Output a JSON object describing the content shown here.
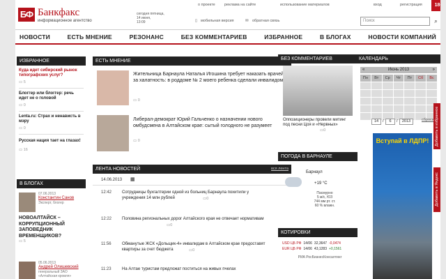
{
  "header": {
    "logo_short": "БФ",
    "logo_name": "Банкфакс",
    "logo_sub": "информационное агентство",
    "date_lines": [
      "сегодня пятница,",
      "14 июня,",
      "13:09"
    ],
    "top_links": [
      "о проекте",
      "реклама на сайте",
      "использование материалов"
    ],
    "login": "вход",
    "register": "регистрация",
    "age": "18+",
    "mobile": "мобильная версия",
    "feedback": "обратная связь",
    "search_placeholder": "Поиск"
  },
  "nav": [
    "НОВОСТИ",
    "ЕСТЬ МНЕНИЕ",
    "РЕЗОНАНС",
    "БЕЗ КОММЕНТАРИЕВ",
    "ИЗБРАННОЕ",
    "В БЛОГАХ",
    "НОВОСТИ КОМПАНИЙ"
  ],
  "featured": {
    "title": "ИЗБРАННОЕ",
    "items": [
      {
        "text": "Куда идет сибирский рынок типографских услуг?",
        "comments": "5"
      },
      {
        "text": "Блоггер или блоггер: речь идет не о головой",
        "comments": "0"
      },
      {
        "text": "Lenta.ru: Страх и ненависть в мэру",
        "comments": "0"
      },
      {
        "text": "Русская нация тает на глазах!",
        "comments": "16"
      }
    ]
  },
  "blogs": {
    "title": "В БЛОГАХ",
    "items": [
      {
        "date": "07.06.2013",
        "author": "Константин Санов",
        "role": "Эксперт, блогер",
        "text": "НОВОАЛТАЙСК – КОРРУПЦИОННЫЙ ЗАПОВЕДНИК ВРЕМЕНЩИКОВ?",
        "comments": "5"
      },
      {
        "date": "05.06.2013",
        "author": "Андрей Олишевский",
        "role": "генеральный ЗАО «Алтайская кровля»",
        "text": ""
      }
    ]
  },
  "opinion": {
    "title": "ЕСТЬ МНЕНИЕ",
    "items": [
      {
        "text": "Жительница Барнаула Наталья Игошина требует наказать врачей за халатность: в роддоме № 2 моего ребенка сделали инвалидом!",
        "comments": "0"
      },
      {
        "text": "Либерал-демократ Юрий Гальченко о назначении нового омбудсмена в Алтайском крае: сытый голодного не разумеет",
        "comments": "0"
      }
    ]
  },
  "feed": {
    "title": "ЛЕНТА НОВОСТЕЙ",
    "all_label": "вся лента",
    "date": "14.06.2013",
    "items": [
      {
        "time": "12:42",
        "text": "Сотрудницы бухгалтерии одной из больниц Барнаула похитили у учреждения 14 млн рублей",
        "comments": "0"
      },
      {
        "time": "12:22",
        "text": "Половина региональных дорог Алтайского края не отвечает нормативам",
        "comments": "0"
      },
      {
        "time": "11:56",
        "text": "Обманутые ЖСК «Дольщик-4» инвалидам в Алтайском крае предоставят квартиры за счет бюджета",
        "comments": "0"
      },
      {
        "time": "11:23",
        "text": "На Алтае туристам предложат поститься на живых пчелах",
        "comments": "0"
      }
    ]
  },
  "no_comments": {
    "title": "БЕЗ КОММЕНТАРИЕВ",
    "caption": "Оппозиционеры провели митинг под песни Цоя и «Нервных»",
    "comments": "0"
  },
  "weather": {
    "title": "ПОГОДА В БАРНАУЛЕ",
    "city": "Барнаул",
    "temp": "+19 °C",
    "details": [
      "Пасмурно",
      "5 м/с, ЮЗ",
      "744 мм рт. ст.",
      "60 % влажн."
    ]
  },
  "quotes": {
    "title": "КОТИРОВКИ",
    "rows": [
      [
        "USD ЦБ РФ",
        "14/06",
        "32,3647",
        "-0,0474"
      ],
      [
        "EUR ЦБ РФ",
        "14/06",
        "43,1283",
        "+0,1561"
      ]
    ],
    "source": "РИА РосБизнесКонсалтинг"
  },
  "calendar": {
    "title": "КАЛЕНДАРЬ",
    "month": "Июнь 2013",
    "weekdays": [
      "Пн",
      "Вт",
      "Ср",
      "Чт",
      "Пт",
      "Сб",
      "Вс"
    ],
    "input_day": "14",
    "input_month": "6",
    "input_year": "2013",
    "reset": "сбросить"
  },
  "ad": {
    "text": "Вступай в ЛДПР!"
  },
  "side_buttons": [
    "Добавить в избранное",
    "Добавить в Яндекс"
  ],
  "colors": {
    "brand": "#b5121b",
    "dark": "#222222"
  }
}
